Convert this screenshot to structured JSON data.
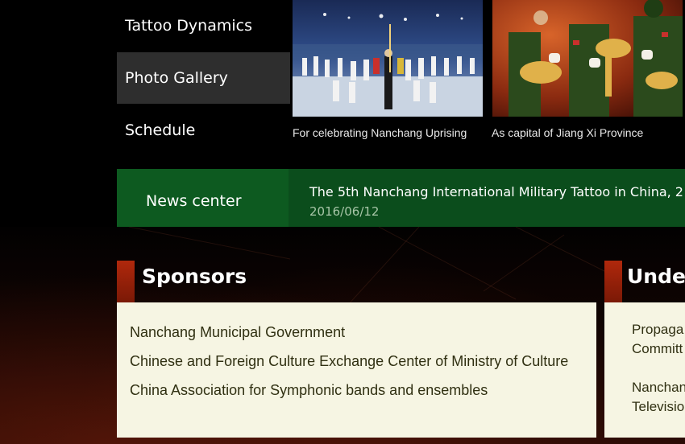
{
  "nav": {
    "items": [
      {
        "label": "Tattoo Dynamics",
        "active": false
      },
      {
        "label": "Photo Gallery",
        "active": true
      },
      {
        "label": "Schedule",
        "active": false
      }
    ]
  },
  "gallery": {
    "photos": [
      {
        "caption": "For celebrating Nanchang Uprising",
        "icon": "marching-band-photo"
      },
      {
        "caption": "As capital of Jiang Xi Province",
        "icon": "brass-band-photo"
      }
    ]
  },
  "news": {
    "label": "News center",
    "title": "The 5th Nanchang International Military Tattoo in China, 2",
    "date": "2016/06/12"
  },
  "sponsors": {
    "title": "Sponsors",
    "items": [
      "Nanchang Municipal Government",
      "Chinese and Foreign Culture Exchange Center of Ministry of Culture",
      "China Association for Symphonic bands and ensembles"
    ]
  },
  "undertakers": {
    "title": "Under",
    "items": [
      {
        "line1": "Propaga",
        "line2": "Committ"
      },
      {
        "line1": "Nanchan",
        "line2": "Televisio"
      }
    ]
  },
  "colors": {
    "news_bg": "#0b4d1c",
    "news_label_bg": "#0d5a20",
    "panel_accent": "#b0280c",
    "panel_body": "#f6f5e3",
    "nav_active": "#2e2e2e"
  }
}
